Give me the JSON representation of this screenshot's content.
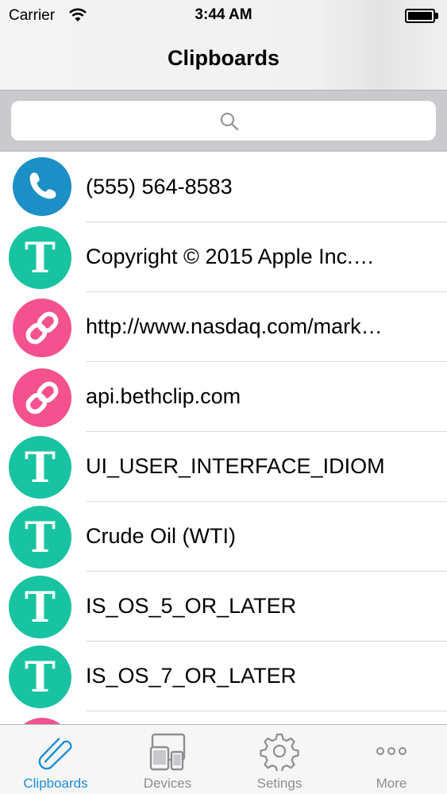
{
  "status_bar": {
    "carrier": "Carrier",
    "time": "3:44 AM"
  },
  "nav": {
    "title": "Clipboards"
  },
  "search": {
    "placeholder": ""
  },
  "items": [
    {
      "type": "phone",
      "icon": "phone-icon",
      "text": "(555) 564-8583"
    },
    {
      "type": "text",
      "icon": "text-icon",
      "text": "Copyright © 2015 Apple Inc.…"
    },
    {
      "type": "link",
      "icon": "link-icon",
      "text": "http://www.nasdaq.com/mark…"
    },
    {
      "type": "link",
      "icon": "link-icon",
      "text": "api.bethclip.com"
    },
    {
      "type": "text",
      "icon": "text-icon",
      "text": "UI_USER_INTERFACE_IDIOM"
    },
    {
      "type": "text",
      "icon": "text-icon",
      "text": "Crude Oil (WTI)"
    },
    {
      "type": "text",
      "icon": "text-icon",
      "text": "IS_OS_5_OR_LATER"
    },
    {
      "type": "text",
      "icon": "text-icon",
      "text": "IS_OS_7_OR_LATER"
    }
  ],
  "tabs": [
    {
      "label": "Clipboards",
      "icon": "paperclip-icon",
      "active": true
    },
    {
      "label": "Devices",
      "icon": "devices-icon",
      "active": false
    },
    {
      "label": "Setings",
      "icon": "gear-icon",
      "active": false
    },
    {
      "label": "More",
      "icon": "more-icon",
      "active": false
    }
  ],
  "colors": {
    "phone": "#1b8fc6",
    "text": "#18c3a1",
    "link": "#f3528f",
    "accent": "#1a8dd8",
    "tab_inactive": "#8e8e93"
  },
  "glyphs": {
    "text_avatar": "T"
  }
}
